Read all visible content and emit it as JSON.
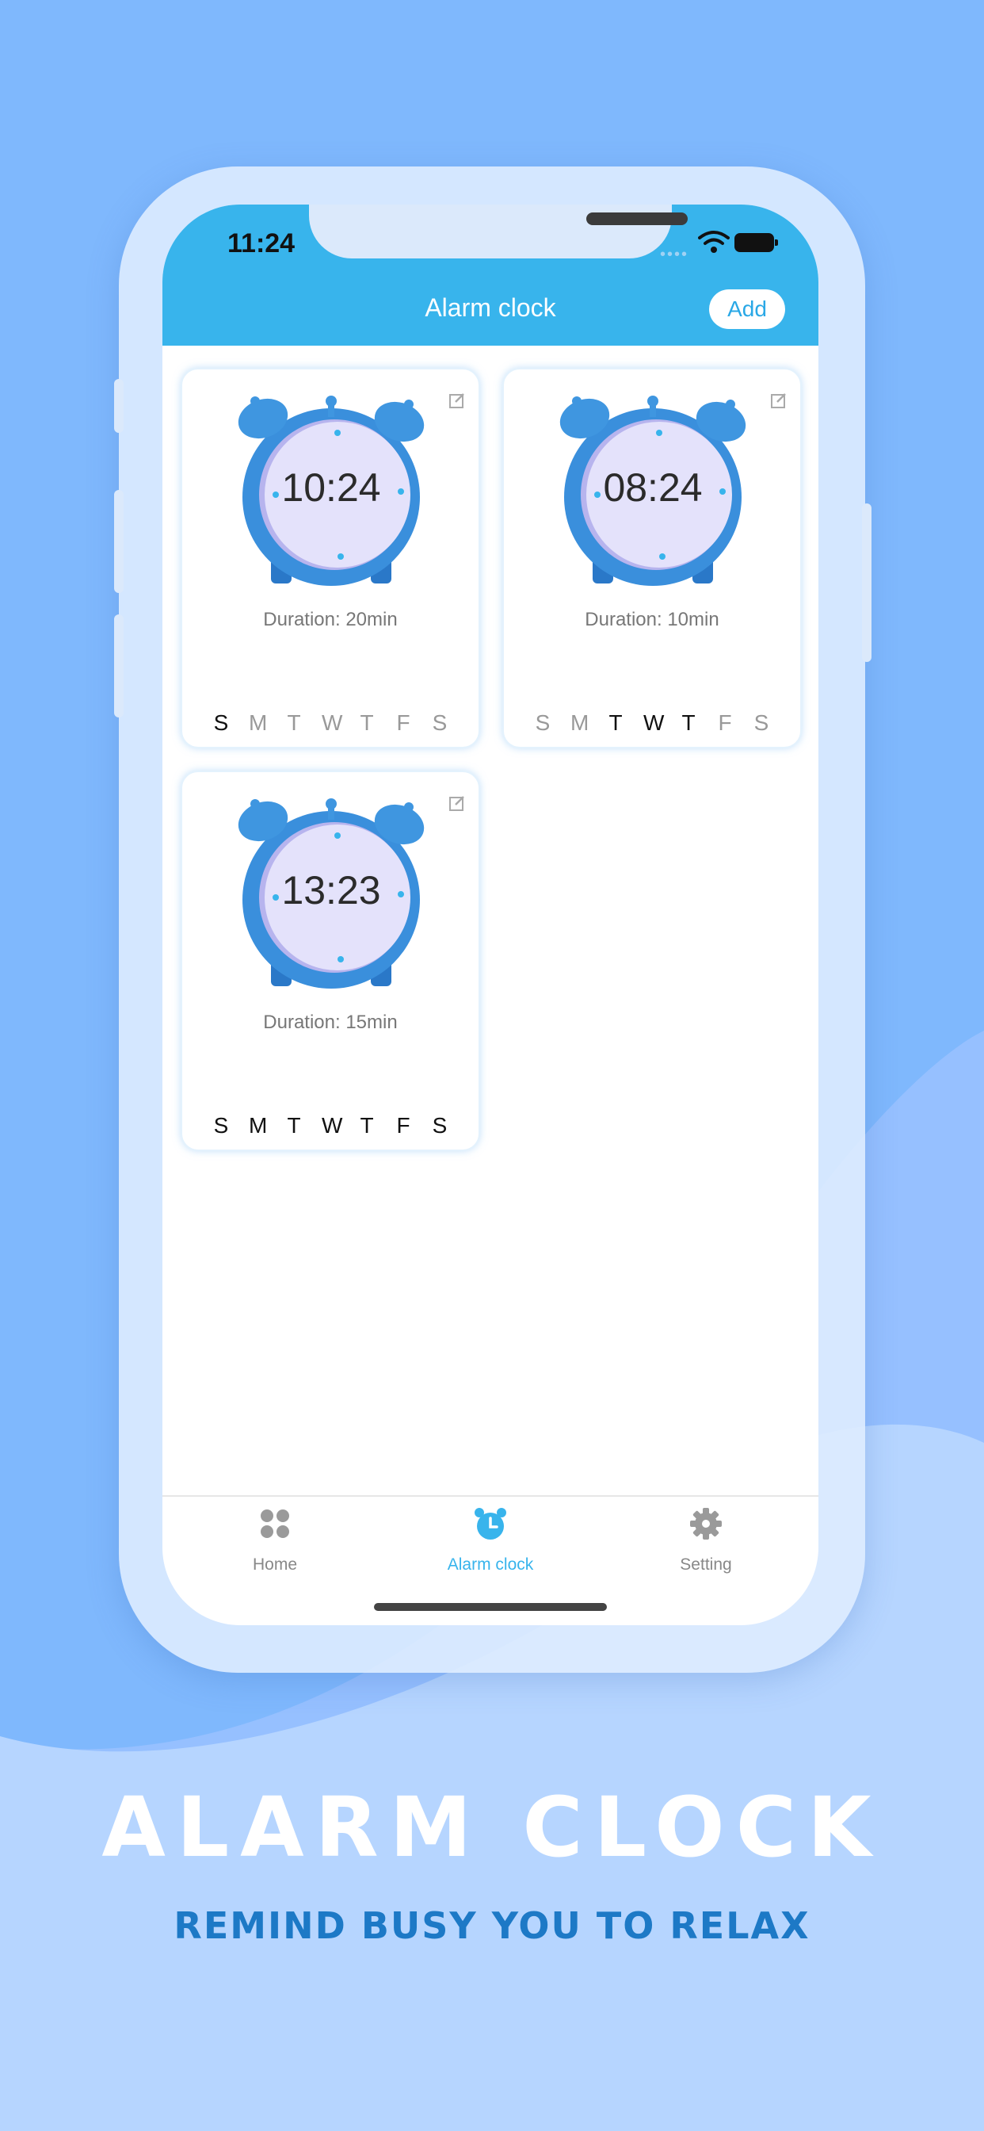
{
  "status_bar": {
    "time": "11:24"
  },
  "header": {
    "title": "Alarm clock",
    "add_label": "Add"
  },
  "alarms": [
    {
      "time": "10:24",
      "duration": "Duration: 20min",
      "days": [
        "S",
        "M",
        "T",
        "W",
        "T",
        "F",
        "S"
      ],
      "active_days": [
        true,
        false,
        false,
        false,
        false,
        false,
        false
      ]
    },
    {
      "time": "08:24",
      "duration": "Duration: 10min",
      "days": [
        "S",
        "M",
        "T",
        "W",
        "T",
        "F",
        "S"
      ],
      "active_days": [
        false,
        false,
        true,
        true,
        true,
        false,
        false
      ]
    },
    {
      "time": "13:23",
      "duration": "Duration: 15min",
      "days": [
        "S",
        "M",
        "T",
        "W",
        "T",
        "F",
        "S"
      ],
      "active_days": [
        true,
        true,
        true,
        true,
        true,
        true,
        true
      ]
    }
  ],
  "tabbar": {
    "items": [
      {
        "label": "Home",
        "icon": "grid-icon",
        "active": false
      },
      {
        "label": "Alarm clock",
        "icon": "alarm-clock-icon",
        "active": true
      },
      {
        "label": "Setting",
        "icon": "gear-icon",
        "active": false
      }
    ]
  },
  "promo": {
    "title": "ALARM CLOCK",
    "subtitle": "REMIND BUSY YOU TO RELAX"
  },
  "colors": {
    "accent": "#38b4ec",
    "background": "#7fb8fd",
    "inactive_tab": "#888888",
    "promo_subtitle": "#1d79c6"
  }
}
